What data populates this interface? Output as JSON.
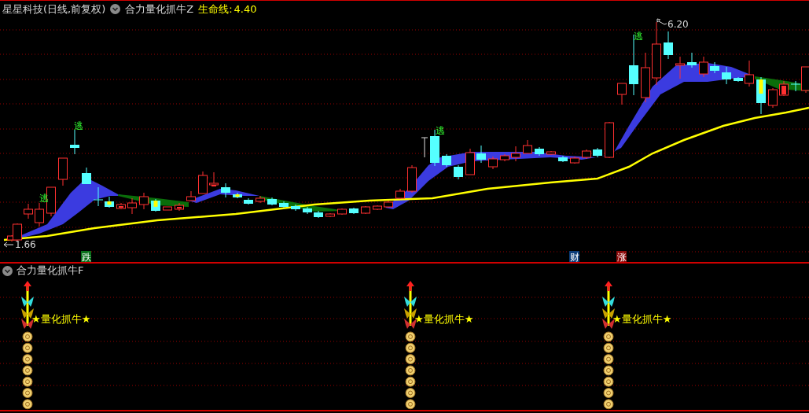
{
  "header": {
    "security": "星星科技(日线,前复权)",
    "indicator": "合力量化抓牛Z",
    "line_label": "生命线:",
    "line_value": "4.40"
  },
  "main_chart": {
    "markers": [
      {
        "kind": "escape",
        "text": "逃"
      },
      {
        "kind": "escape",
        "text": "逃"
      },
      {
        "kind": "escape",
        "text": "逃"
      },
      {
        "kind": "escape",
        "text": "逃"
      }
    ],
    "high_label": "6.20",
    "low_label": "1.66",
    "badges": [
      {
        "text": "跌",
        "color": "#0a6e1a"
      },
      {
        "text": "财",
        "color": "#0b3c78"
      },
      {
        "text": "涨",
        "color": "#8c0a0a"
      }
    ]
  },
  "sub_panel": {
    "title": "合力量化抓牛F",
    "signals": [
      {
        "label": "★量化抓牛★"
      },
      {
        "label": "★量化抓牛★"
      },
      {
        "label": "★量化抓牛★"
      }
    ]
  }
}
